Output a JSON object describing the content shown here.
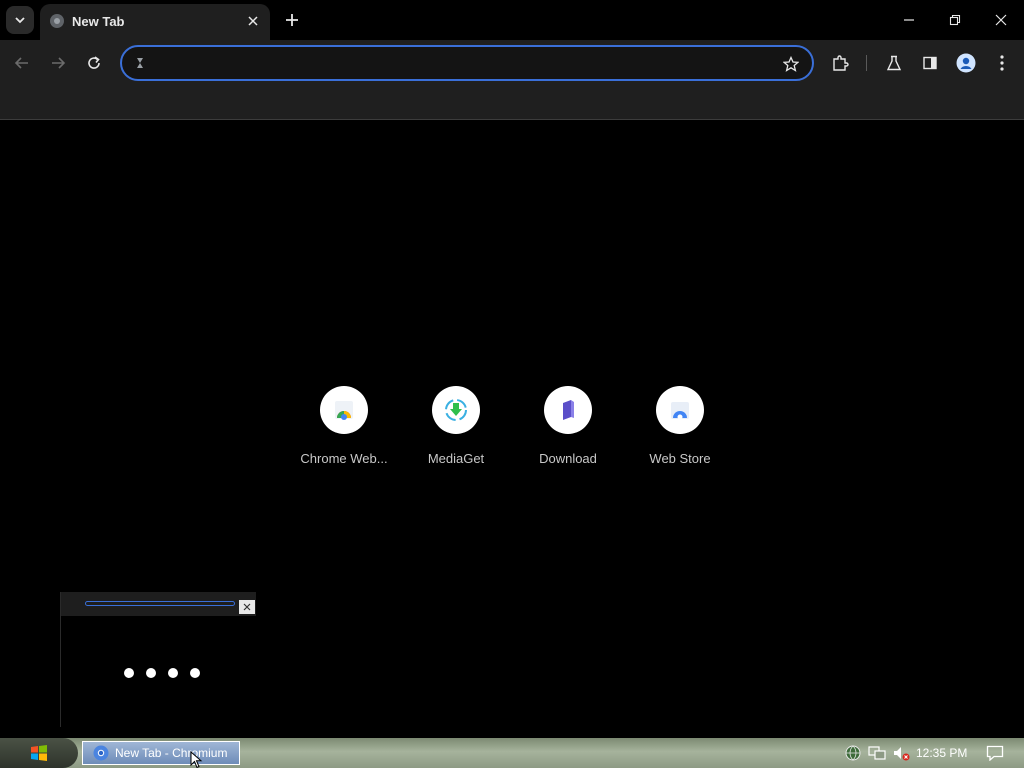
{
  "browser": {
    "tab": {
      "title": "New Tab",
      "favicon": "chromium-globe-icon"
    },
    "omnibox": {
      "value": "",
      "placeholder": ""
    },
    "colors": {
      "accent": "#3a6fd8",
      "toolbar": "#1f1f1f",
      "frame": "#000000"
    }
  },
  "new_tab": {
    "shortcuts": [
      {
        "label": "Chrome Web...",
        "icon": "chrome-web-store-icon"
      },
      {
        "label": "MediaGet",
        "icon": "mediaget-icon"
      },
      {
        "label": "Download",
        "icon": "download-icon"
      },
      {
        "label": "Web Store",
        "icon": "web-store-icon"
      }
    ]
  },
  "taskbar": {
    "task_label": "New Tab - Chromium",
    "clock": "12:35 PM"
  }
}
